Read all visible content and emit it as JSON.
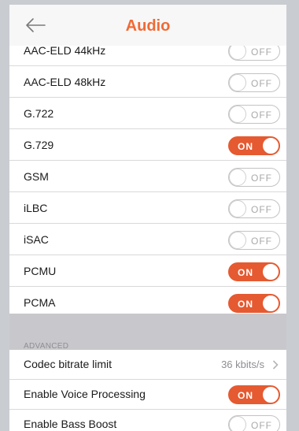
{
  "header": {
    "title": "Audio",
    "back_icon": "back-arrow-icon"
  },
  "codecs": [
    {
      "label": "AAC-ELD 44kHz",
      "state": "OFF"
    },
    {
      "label": "AAC-ELD 48kHz",
      "state": "OFF"
    },
    {
      "label": "G.722",
      "state": "OFF"
    },
    {
      "label": "G.729",
      "state": "ON"
    },
    {
      "label": "GSM",
      "state": "OFF"
    },
    {
      "label": "iLBC",
      "state": "OFF"
    },
    {
      "label": "iSAC",
      "state": "OFF"
    },
    {
      "label": "PCMU",
      "state": "ON"
    },
    {
      "label": "PCMA",
      "state": "ON"
    }
  ],
  "advanced": {
    "section_title": "ADVANCED",
    "codec_bitrate": {
      "label": "Codec bitrate limit",
      "value": "36 kbits/s",
      "icon": "chevron-right-icon"
    },
    "voice_processing": {
      "label": "Enable Voice Processing",
      "state": "ON"
    },
    "bass_boost": {
      "label": "Enable Bass Boost",
      "state": "OFF"
    }
  },
  "colors": {
    "accent": "#f06a35",
    "toggle_on": "#e55a31",
    "section_bg": "#c8c8cc",
    "label": "#1a1a1a",
    "secondary": "#8e8e93"
  }
}
